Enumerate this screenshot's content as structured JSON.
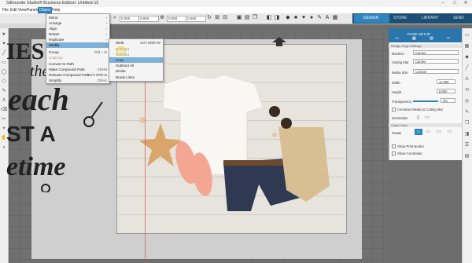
{
  "window": {
    "title": "Silhouette Studio® Business Edition: Untitled-15",
    "controls": [
      "–",
      "□",
      "✕"
    ]
  },
  "menubar": {
    "items": [
      "File",
      "Edit",
      "View",
      "Panels",
      "Object",
      "Help"
    ],
    "active": "Object"
  },
  "toolbar": {
    "field1": "0.000",
    "field2": "0.000",
    "field3": "0.000",
    "field4": "0.000"
  },
  "top_tabs": [
    "DESIGN",
    "STORE",
    "LIBRARY",
    "SEND"
  ],
  "object_menu": {
    "items": [
      {
        "label": "Mirror",
        "shortcut": "",
        "arrow": "›"
      },
      {
        "label": "Arrange",
        "shortcut": "",
        "arrow": "›"
      },
      {
        "label": "Align",
        "shortcut": "",
        "arrow": "›"
      },
      {
        "label": "Rotate",
        "shortcut": "",
        "arrow": "›"
      },
      {
        "label": "Replicate",
        "shortcut": "",
        "arrow": "›"
      },
      {
        "label": "Modify",
        "shortcut": "",
        "arrow": "›"
      },
      {
        "label": "Group",
        "shortcut": "Ctrl + G",
        "arrow": ""
      },
      {
        "label": "Ungroup",
        "shortcut": "",
        "arrow": ""
      },
      {
        "label": "Convert to Path",
        "shortcut": "",
        "arrow": ""
      },
      {
        "label": "Make Compound Path",
        "shortcut": "Ctrl+8",
        "arrow": ""
      },
      {
        "label": "Release Compound Path",
        "shortcut": "Ctrl+Shift+8",
        "arrow": ""
      },
      {
        "label": "Simplify",
        "shortcut": "Ctrl+1",
        "arrow": ""
      }
    ],
    "selected": "Modify"
  },
  "modify_submenu": {
    "items": [
      {
        "label": "Weld",
        "shortcut": "Ctrl+Shift+W"
      },
      {
        "label": "Subtract",
        "shortcut": ""
      },
      {
        "label": "Subtract",
        "shortcut": ""
      },
      {
        "label": "Crop",
        "shortcut": ""
      },
      {
        "label": "Subtract All",
        "shortcut": ""
      },
      {
        "label": "Divide",
        "shortcut": ""
      },
      {
        "label": "Break Links",
        "shortcut": ""
      }
    ],
    "selected": "Crop"
  },
  "right_panel": {
    "header": "PAGE SETUP",
    "section_media": "Design Page Settings",
    "machine_label": "Machine",
    "machine_value": "Cameo",
    "cutting_mat_label": "Cutting Mat",
    "cutting_mat_value": "Cameo",
    "media_size_label": "Media Size",
    "media_size_value": "Custom",
    "width_label": "Width",
    "width_value": "11.000",
    "height_label": "Height",
    "height_value": "8.500",
    "transparency_label": "Transparency",
    "transparency_value": "0%",
    "constrain_label": "Constrain Media to Cutting Mat",
    "orientation_label": "Orientation",
    "section_view": "Cutter View",
    "rotate_label": "Rotate",
    "show_print_border": "Show Print Border",
    "show_cut_border": "Show Cut Border"
  },
  "design_text": {
    "line1": "IES M",
    "line2": "the",
    "line3": "each",
    "line4": "ST A",
    "line5": "etime"
  },
  "colors": {
    "accent": "#2c85bf",
    "menu_highlight": "#7fb0d8",
    "workspace": "#707070",
    "mat": "#bdbdbd"
  }
}
